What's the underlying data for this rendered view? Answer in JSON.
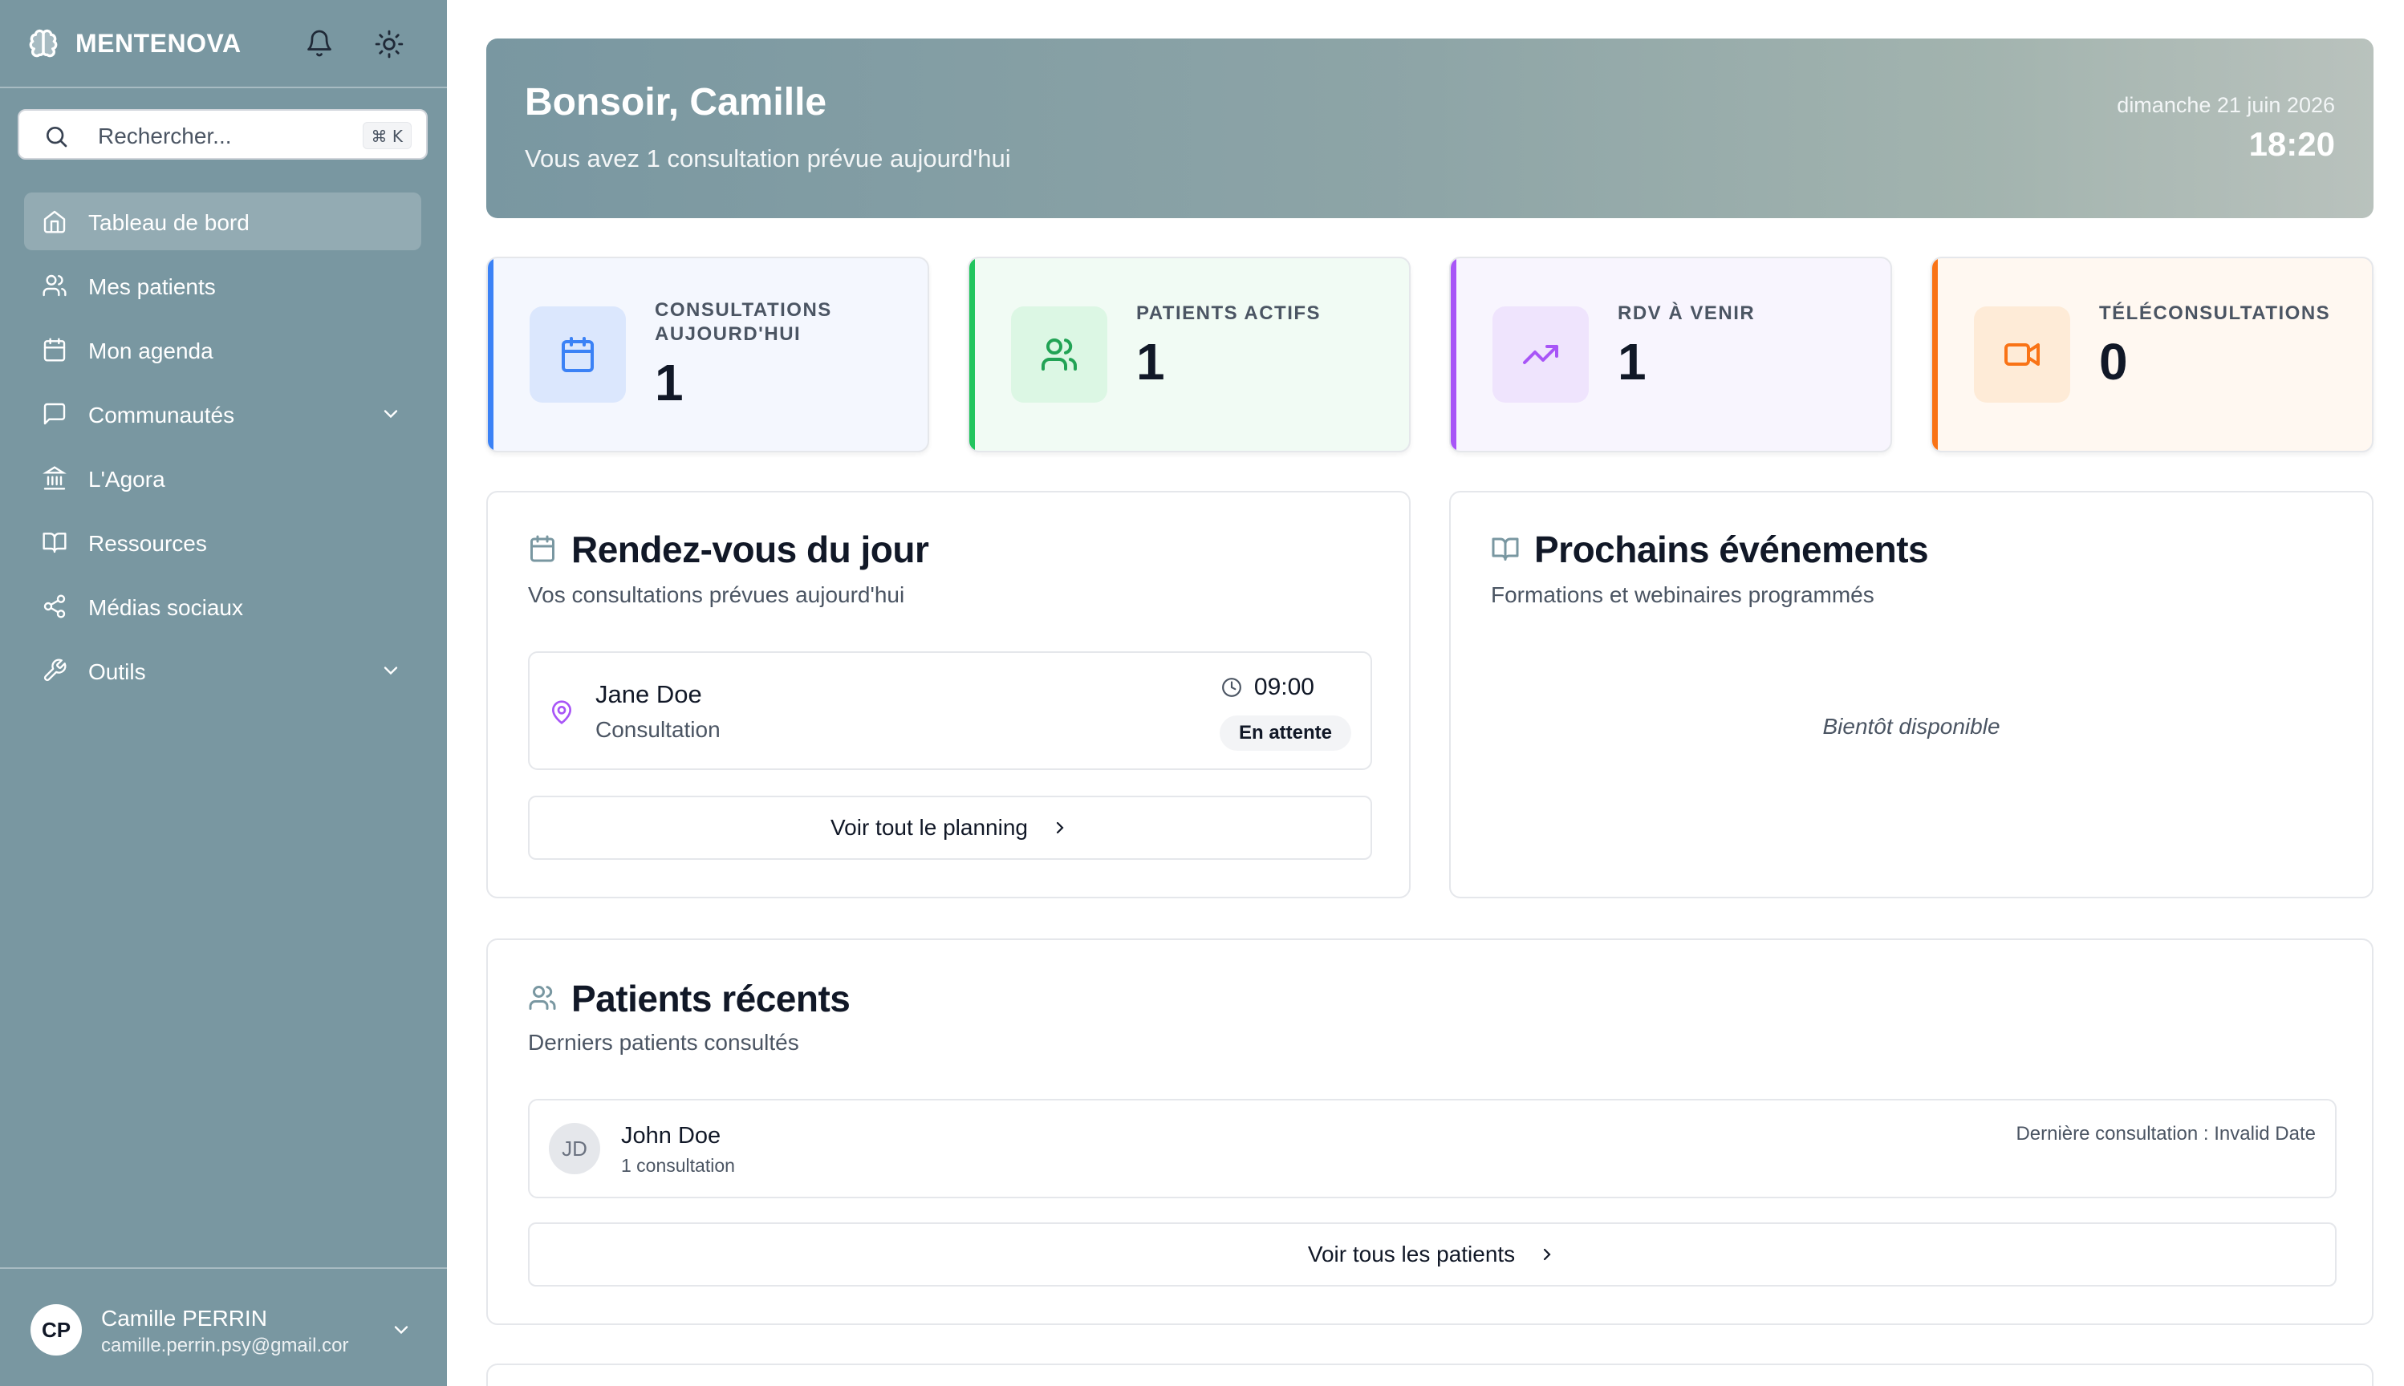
{
  "app": {
    "brand": "MENTENOVA"
  },
  "search": {
    "placeholder": "Rechercher...",
    "shortcut": "⌘ K"
  },
  "sidebar": {
    "items": [
      {
        "label": "Tableau de bord",
        "icon": "home-icon",
        "active": true
      },
      {
        "label": "Mes patients",
        "icon": "users-icon"
      },
      {
        "label": "Mon agenda",
        "icon": "calendar-icon"
      },
      {
        "label": "Communautés",
        "icon": "message-icon",
        "expandable": true
      },
      {
        "label": "L'Agora",
        "icon": "landmark-icon"
      },
      {
        "label": "Ressources",
        "icon": "book-icon"
      },
      {
        "label": "Médias sociaux",
        "icon": "share-icon"
      },
      {
        "label": "Outils",
        "icon": "wrench-icon",
        "expandable": true
      }
    ]
  },
  "user": {
    "initials": "CP",
    "name": "Camille PERRIN",
    "email": "camille.perrin.psy@gmail.cor"
  },
  "hero": {
    "greeting": "Bonsoir, Camille",
    "subtitle": "Vous avez 1 consultation prévue aujourd'hui",
    "date": "dimanche 21 juin 2026",
    "time": "18:20"
  },
  "stats": [
    {
      "label": "CONSULTATIONS AUJOURD'HUI",
      "value": "1",
      "icon": "calendar-icon",
      "accent": "#3b82f6",
      "bg": "#f4f7fe",
      "icon_bg": "#dbe7fd"
    },
    {
      "label": "PATIENTS ACTIFS",
      "value": "1",
      "icon": "users-icon",
      "accent": "#22c55e",
      "bg": "#f1fbf4",
      "icon_bg": "#dcf7e4"
    },
    {
      "label": "RDV À VENIR",
      "value": "1",
      "icon": "trending-up-icon",
      "accent": "#a855f7",
      "bg": "#f8f5fe",
      "icon_bg": "#efe4fd"
    },
    {
      "label": "TÉLÉCONSULTATIONS",
      "value": "0",
      "icon": "video-icon",
      "accent": "#f97316",
      "bg": "#fff8f1",
      "icon_bg": "#feebd7"
    }
  ],
  "appointments": {
    "title": "Rendez-vous du jour",
    "subtitle": "Vos consultations prévues aujourd'hui",
    "items": [
      {
        "name": "Jane Doe",
        "type": "Consultation",
        "time": "09:00",
        "status": "En attente"
      }
    ],
    "button": "Voir tout le planning"
  },
  "events": {
    "title": "Prochains événements",
    "subtitle": "Formations et webinaires programmés",
    "empty": "Bientôt disponible"
  },
  "recent_patients": {
    "title": "Patients récents",
    "subtitle": "Derniers patients consultés",
    "items": [
      {
        "initials": "JD",
        "name": "John Doe",
        "count": "1 consultation",
        "last": "Dernière consultation : Invalid Date"
      }
    ],
    "button": "Voir tous les patients"
  }
}
